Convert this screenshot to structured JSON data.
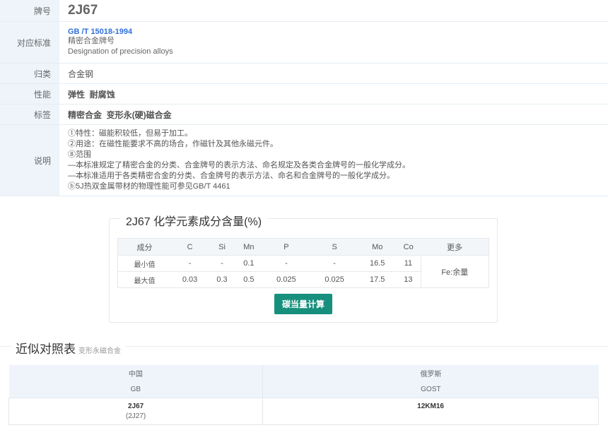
{
  "info": {
    "grade_label": "牌号",
    "grade": "2J67",
    "standard_label": "对应标准",
    "standard_code": "GB /T 15018-1994",
    "standard_name_cn": "精密合金牌号",
    "standard_name_en": "Designation of precision alloys",
    "category_label": "归类",
    "category": "合金钢",
    "property_label": "性能",
    "properties": "弹性  耐腐蚀",
    "tag_label": "标签",
    "tags": "精密合金  变形永(硬)磁合金",
    "desc_label": "说明",
    "desc_lines": [
      "①特性：磁能积较低，但易于加工。",
      "②用途：在磁性能要求不高的场合，作磁针及其他永磁元件。",
      "⑧范围",
      "—本标准规定了精密合金的分类、合金牌号的表示方法、命名规定及各类合金牌号的一般化学成分。",
      "—本标准适用于各类精密合金的分类、合金牌号的表示方法、命名和合金牌号的一般化学成分。",
      "ⓑ5J热双金属带材的物理性能可参见GB/T 4461"
    ]
  },
  "composition": {
    "title": "2J67 化学元素成分含量(%)",
    "headers": [
      "成分",
      "C",
      "Si",
      "Mn",
      "P",
      "S",
      "Mo",
      "Co",
      "更多"
    ],
    "min_label": "最小值",
    "min_values": [
      "-",
      "-",
      "0.1",
      "-",
      "-",
      "16.5",
      "11"
    ],
    "max_label": "最大值",
    "max_values": [
      "0.03",
      "0.3",
      "0.5",
      "0.025",
      "0.025",
      "17.5",
      "13"
    ],
    "more": "Fe:余量",
    "calc_button": "碳当量计算"
  },
  "comparison": {
    "title": "近似对照表",
    "subtitle": "变形永磁合金",
    "columns": [
      {
        "country": "中国",
        "standard": "GB",
        "grade": "2J67",
        "alias": "(2J27)"
      },
      {
        "country": "俄罗斯",
        "standard": "GOST",
        "grade": "12KM16",
        "alias": ""
      }
    ]
  },
  "colors": {
    "label_bg": "#eef4fa",
    "link_blue": "#2f6fdc",
    "button_green": "#178f7d"
  }
}
